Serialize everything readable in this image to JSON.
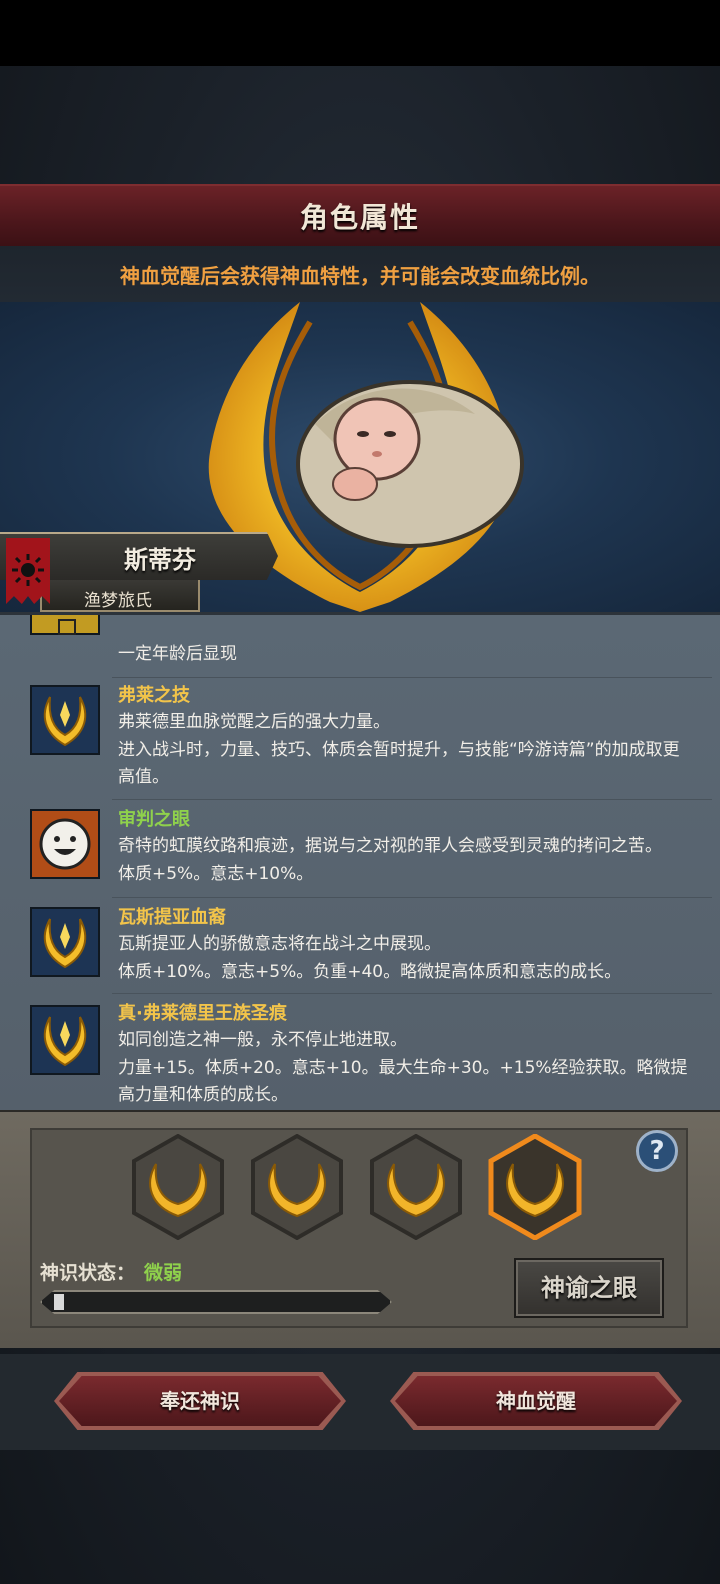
{
  "header": {
    "title": "角色属性",
    "subtitle": "神血觉醒后会获得神血特性，并可能会改变血统比例。"
  },
  "character": {
    "name": "斯蒂芬",
    "clan": "渔梦旅氏"
  },
  "traits": [
    {
      "name": "",
      "desc": "一定年龄后显现",
      "icon": "locked-trait-icon"
    },
    {
      "name": "弗莱之技",
      "name_color": "#f2c44a",
      "desc": "弗莱德里血脉觉醒之后的强大力量。\n进入战斗时，力量、技巧、体质会暂时提升，与技能“吟游诗篇”的加成取更高值。",
      "icon": "golden-crest-icon"
    },
    {
      "name": "审判之眼",
      "name_color": "#8fd14c",
      "desc": "奇特的虹膜纹路和痕迹，据说与之对视的罪人会感受到灵魂的拷问之苦。\n体质+5%。意志+10%。",
      "icon": "smiling-face-icon"
    },
    {
      "name": "瓦斯提亚血裔",
      "name_color": "#f2c44a",
      "desc": "瓦斯提亚人的骄傲意志将在战斗之中展现。\n体质+10%。意志+5%。负重+40。略微提高体质和意志的成长。",
      "icon": "golden-crest-icon"
    },
    {
      "name": "真·弗莱德里王族圣痕",
      "name_color": "#f2c44a",
      "desc": "如同创造之神一般，永不停止地进取。\n力量+15。体质+20。意志+10。最大生命+30。+15%经验获取。略微提高力量和体质的成长。",
      "icon": "golden-crest-icon"
    }
  ],
  "awaken": {
    "slots": [
      "laurel-icon",
      "laurel-icon",
      "laurel-icon",
      "laurel-icon-active"
    ],
    "status_label": "神识状态：",
    "status_value": "微弱",
    "progress": 0.03,
    "oracle_button": "神谕之眼",
    "help": "?"
  },
  "actions": {
    "return_label": "奉还神识",
    "awaken_label": "神血觉醒"
  },
  "colors": {
    "accent_orange": "#f0a041",
    "banner_red": "#6b2227",
    "status_green": "#8fd14c"
  }
}
